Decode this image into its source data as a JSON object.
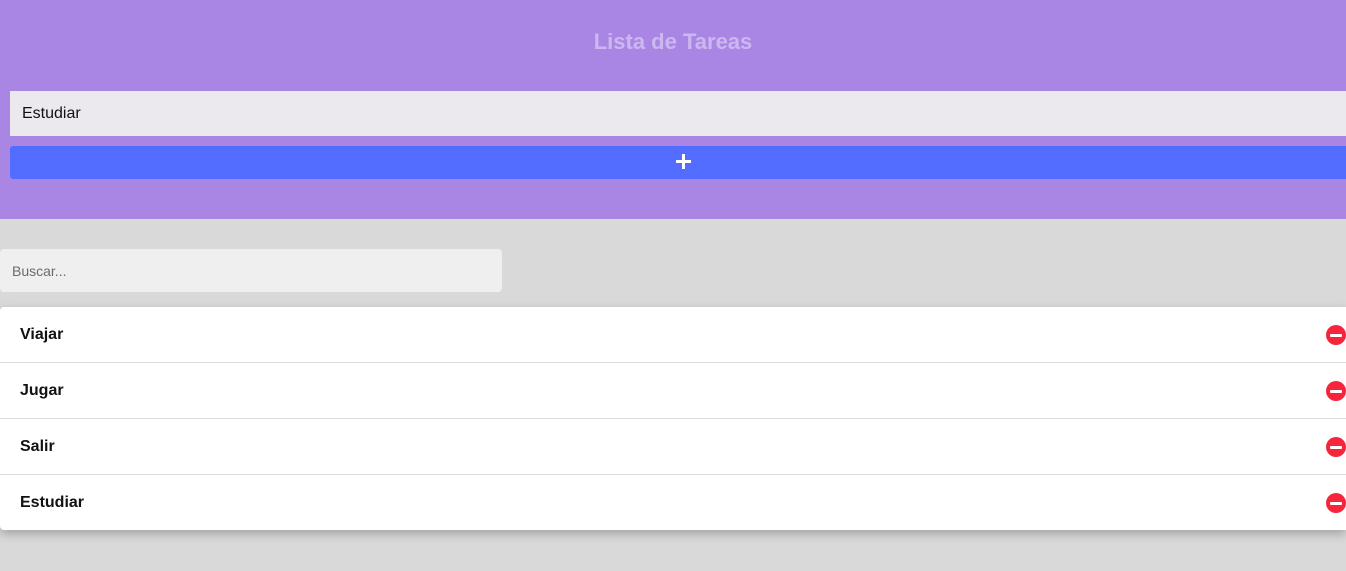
{
  "header": {
    "title": "Lista de Tareas",
    "task_input_value": "Estudiar",
    "add_icon": "plus-icon"
  },
  "search": {
    "placeholder": "Buscar..."
  },
  "tasks": [
    {
      "label": "Viajar",
      "delete_icon": "minus-circle-icon"
    },
    {
      "label": "Jugar",
      "delete_icon": "minus-circle-icon"
    },
    {
      "label": "Salir",
      "delete_icon": "minus-circle-icon"
    },
    {
      "label": "Estudiar",
      "delete_icon": "minus-circle-icon"
    }
  ],
  "colors": {
    "header_bg": "#a986e3",
    "title": "#cdb7f0",
    "add_button": "#526dff",
    "delete_icon": "#f5263c",
    "page_bg": "#d9d9d9"
  }
}
